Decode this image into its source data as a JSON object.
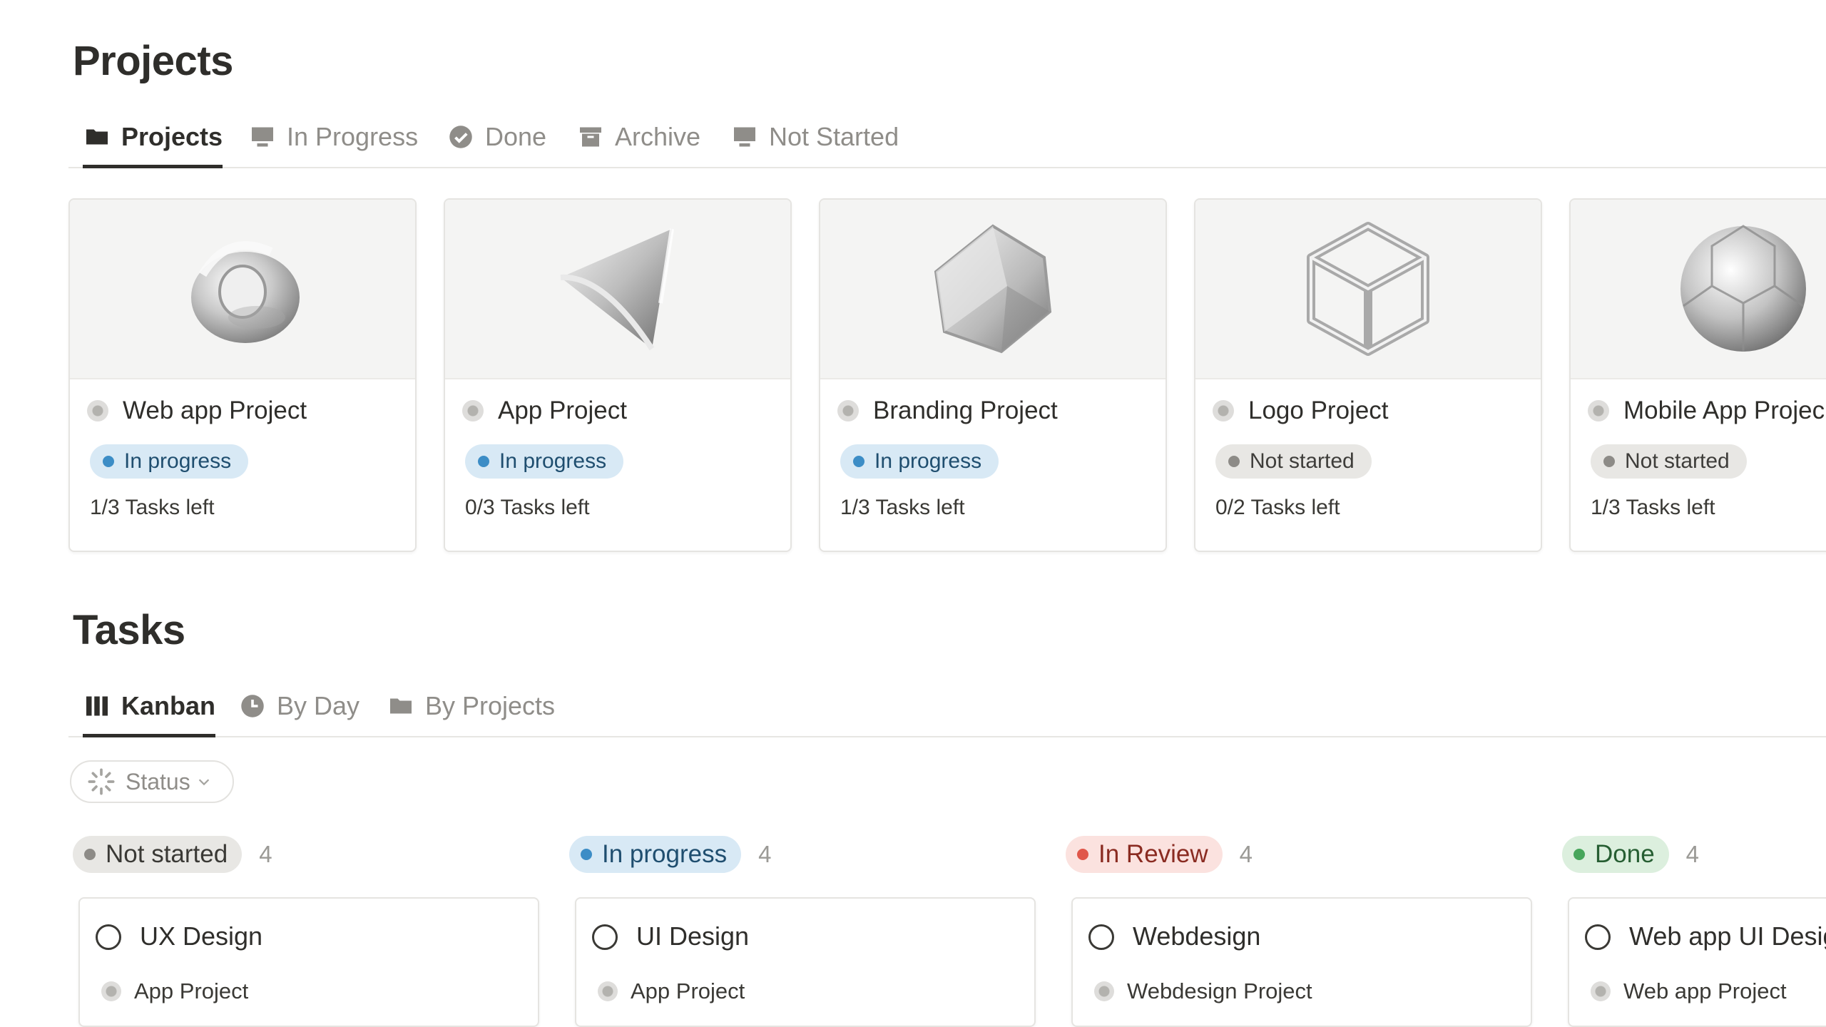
{
  "projects_section": {
    "title": "Projects",
    "tabs": [
      {
        "label": "Projects",
        "icon": "folder-icon"
      },
      {
        "label": "In Progress",
        "icon": "monitor-icon"
      },
      {
        "label": "Done",
        "icon": "check-circle-icon"
      },
      {
        "label": "Archive",
        "icon": "archive-icon"
      },
      {
        "label": "Not Started",
        "icon": "monitor-icon"
      }
    ],
    "active_tab": "Projects",
    "cards": [
      {
        "name": "Web app Project",
        "status": "In progress",
        "tasks_left": "1/3 Tasks left",
        "cover": "glass-torus"
      },
      {
        "name": "App Project",
        "status": "In progress",
        "tasks_left": "0/3 Tasks left",
        "cover": "glass-cone"
      },
      {
        "name": "Branding Project",
        "status": "In progress",
        "tasks_left": "1/3 Tasks left",
        "cover": "glass-polyhedron"
      },
      {
        "name": "Logo Project",
        "status": "Not started",
        "tasks_left": "0/2 Tasks left",
        "cover": "glass-wire-cube"
      },
      {
        "name": "Mobile App Projec",
        "status": "Not started",
        "tasks_left": "1/3 Tasks left",
        "cover": "glass-faceted-sphere"
      }
    ]
  },
  "tasks_section": {
    "title": "Tasks",
    "tabs": [
      {
        "label": "Kanban",
        "icon": "columns-icon"
      },
      {
        "label": "By Day",
        "icon": "clock-icon"
      },
      {
        "label": "By Projects",
        "icon": "folder-icon"
      }
    ],
    "active_tab": "Kanban",
    "filter": {
      "label": "Status",
      "icon": "status-spinner-icon"
    },
    "columns": [
      {
        "status": "Not started",
        "count": "4",
        "color": "#8d8b87",
        "task": {
          "name": "UX Design",
          "project": "App Project"
        }
      },
      {
        "status": "In progress",
        "count": "4",
        "color": "#3c8dc6",
        "task": {
          "name": "UI Design",
          "project": "App Project"
        }
      },
      {
        "status": "In Review",
        "count": "4",
        "color": "#e0574a",
        "task": {
          "name": "Webdesign",
          "project": "Webdesign Project"
        }
      },
      {
        "status": "Done",
        "count": "4",
        "color": "#47a65b",
        "task": {
          "name": "Web app UI Desig",
          "project": "Web app Project"
        }
      }
    ]
  },
  "colors": {
    "in_progress": "#3c8dc6",
    "not_started": "#8d8b87",
    "in_review": "#e0574a",
    "done": "#47a65b"
  }
}
